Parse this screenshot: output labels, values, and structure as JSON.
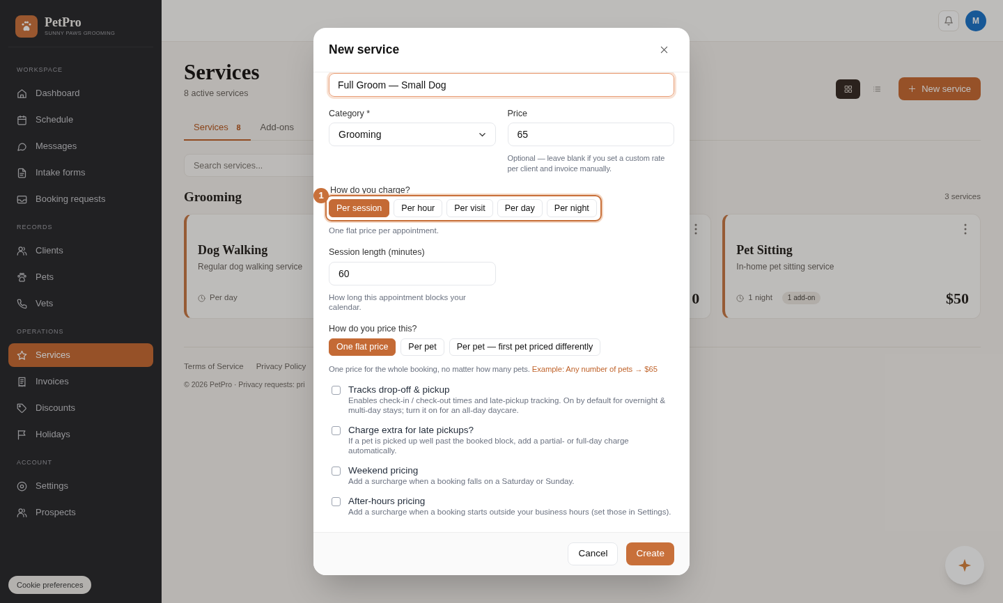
{
  "sidebar": {
    "brand": {
      "name": "PetPro",
      "tagline": "SUNNY PAWS GROOMING"
    },
    "sections": [
      {
        "title": "WORKSPACE",
        "items": [
          {
            "label": "Dashboard",
            "selected": false
          },
          {
            "label": "Schedule",
            "selected": false
          },
          {
            "label": "Messages",
            "selected": false
          },
          {
            "label": "Intake forms",
            "selected": false
          },
          {
            "label": "Booking requests",
            "selected": false
          }
        ]
      },
      {
        "title": "RECORDS",
        "items": [
          {
            "label": "Clients",
            "selected": false
          },
          {
            "label": "Pets",
            "selected": false
          },
          {
            "label": "Vets",
            "selected": false
          }
        ]
      },
      {
        "title": "OPERATIONS",
        "items": [
          {
            "label": "Services",
            "selected": true
          },
          {
            "label": "Invoices",
            "selected": false
          },
          {
            "label": "Discounts",
            "selected": false
          },
          {
            "label": "Holidays",
            "selected": false
          }
        ]
      },
      {
        "title": "ACCOUNT",
        "items": [
          {
            "label": "Settings",
            "selected": false
          },
          {
            "label": "Prospects",
            "selected": false
          }
        ]
      }
    ],
    "cookie_button": "Cookie preferences"
  },
  "top_bar": {
    "avatar_initial": "M"
  },
  "page": {
    "title": "Services",
    "subtitle": "8 active services",
    "view_toggle": [
      {
        "kind": "grid",
        "selected": true
      },
      {
        "kind": "list",
        "selected": false
      }
    ],
    "new_button": "New service",
    "tabs": [
      {
        "label": "Services",
        "count": "8",
        "selected": true
      },
      {
        "label": "Add-ons",
        "selected": false
      }
    ],
    "search": {
      "placeholder": "Search services..."
    },
    "group": {
      "title": "Grooming",
      "count": "3 services",
      "cards": [
        {
          "title": "Dog Walking",
          "description": "Regular dog walking service",
          "duration": "Per day"
        },
        {
          "menu": true,
          "price": "0"
        },
        {
          "menu": true,
          "title": "Pet Sitting",
          "description": "In-home pet sitting service",
          "duration": "1 night",
          "badge": "1 add-on",
          "price": "$50"
        }
      ]
    },
    "footer": {
      "links": [
        "Terms of Service",
        "Privacy Policy"
      ],
      "copyright": "© 2026 PetPro · Privacy requests: pri"
    }
  },
  "modal": {
    "title": "New service",
    "name_field": {
      "value": "Full Groom — Small Dog",
      "focused": true
    },
    "category": {
      "label": "Category *",
      "value": "Grooming"
    },
    "price": {
      "label": "Price",
      "value": "65",
      "hint": "Optional — leave blank if you set a custom rate per client and invoice manually."
    },
    "charge": {
      "label": "How do you charge?",
      "step_badge": "1",
      "options": [
        {
          "label": "Per session",
          "selected": true
        },
        {
          "label": "Per hour",
          "selected": false
        },
        {
          "label": "Per visit",
          "selected": false
        },
        {
          "label": "Per day",
          "selected": false
        },
        {
          "label": "Per night",
          "selected": false
        }
      ],
      "hint": "One flat price per appointment."
    },
    "session_length": {
      "label": "Session length (minutes)",
      "value": "60",
      "hint": "How long this appointment blocks your calendar."
    },
    "pricing": {
      "label": "How do you price this?",
      "options": [
        {
          "label": "One flat price",
          "selected": true
        },
        {
          "label": "Per pet",
          "selected": false
        },
        {
          "label": "Per pet — first pet priced differently",
          "selected": false
        }
      ],
      "hint": "One price for the whole booking, no matter how many pets.",
      "example": "Example: Any number of pets → $65"
    },
    "toggles": [
      {
        "title": "Tracks drop-off & pickup",
        "description": "Enables check-in / check-out times and late-pickup tracking. On by default for overnight & multi-day stays; turn it on for an all-day daycare.",
        "checked": false
      },
      {
        "title": "Charge extra for late pickups?",
        "description": "If a pet is picked up well past the booked block, add a partial- or full-day charge automatically.",
        "checked": false
      },
      {
        "title": "Weekend pricing",
        "description": "Add a surcharge when a booking falls on a Saturday or Sunday.",
        "checked": false
      },
      {
        "title": "After-hours pricing",
        "description": "Add a surcharge when a booking starts outside your business hours (set those in Settings).",
        "checked": false
      }
    ],
    "buttons": {
      "cancel": "Cancel",
      "create": "Create"
    }
  }
}
